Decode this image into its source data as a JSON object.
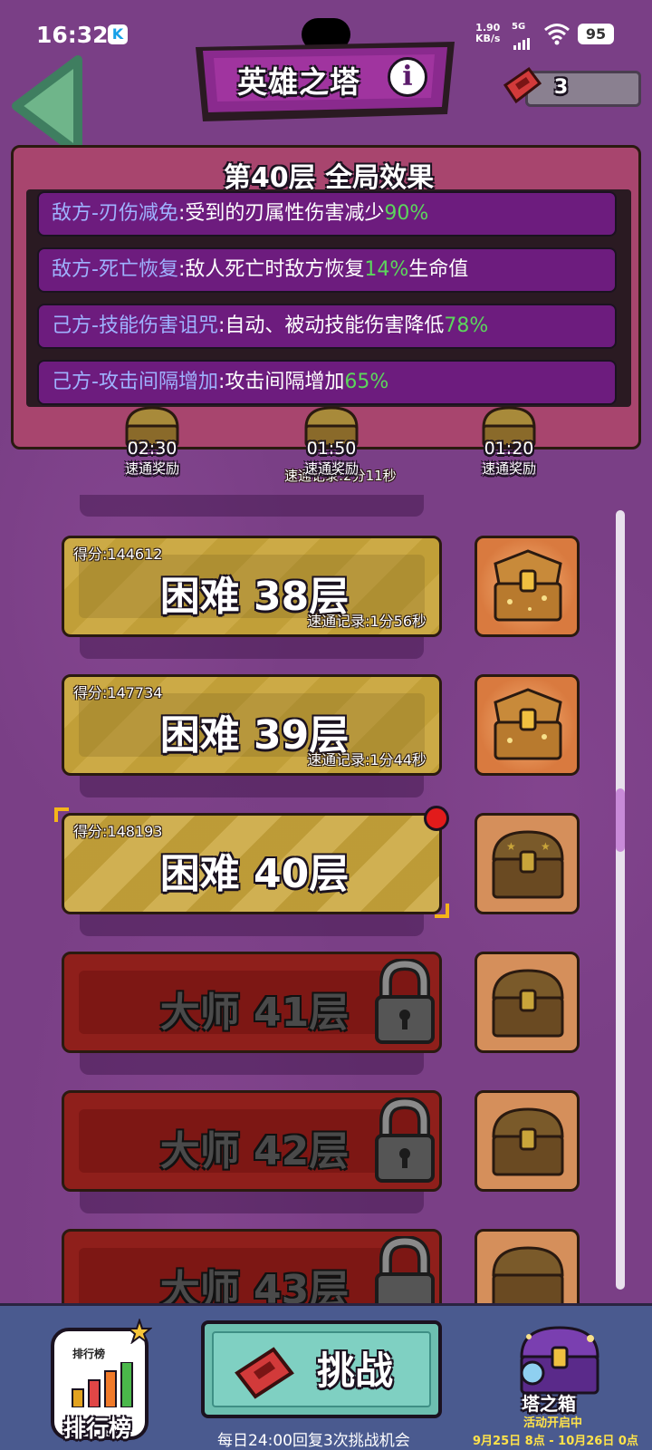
{
  "status_bar": {
    "time": "16:32",
    "app_badge": "K",
    "net_speed_value": "1.90",
    "net_speed_unit": "KB/s",
    "network": "5G",
    "battery": "95"
  },
  "header": {
    "title": "英雄之塔",
    "info_glyph": "i",
    "ticket_count": "3"
  },
  "effects": {
    "title": "第40层 全局效果",
    "items": [
      {
        "name": "敌方-刃伤减免",
        "text": ":受到的刃属性伤害减少",
        "value": "90%",
        "suffix": ""
      },
      {
        "name": "敌方-死亡恢复",
        "text": ":敌人死亡时敌方恢复",
        "value": "14%",
        "suffix": "生命值"
      },
      {
        "name": "己方-技能伤害诅咒",
        "text": ":自动、被动技能伤害降低",
        "value": "78%",
        "suffix": ""
      },
      {
        "name": "己方-攻击间隔增加",
        "text": ":攻击间隔增加",
        "value": "65%",
        "suffix": ""
      }
    ],
    "speed_rewards": [
      {
        "time": "02:30",
        "label": "速通奖励"
      },
      {
        "time": "01:50",
        "label": "速通奖励"
      },
      {
        "time": "01:20",
        "label": "速通奖励"
      }
    ],
    "partial_record": "速通记录:2分11秒"
  },
  "levels": [
    {
      "score": "得分:144612",
      "name": "困难 38层",
      "record": "速通记录:1分56秒"
    },
    {
      "score": "得分:147734",
      "name": "困难 39层",
      "record": "速通记录:1分44秒"
    },
    {
      "score": "得分:148193",
      "name": "困难 40层",
      "record": ""
    },
    {
      "score": "",
      "name": "大师 41层",
      "record": ""
    },
    {
      "score": "",
      "name": "大师 42层",
      "record": ""
    },
    {
      "score": "",
      "name": "大师 43层",
      "record": ""
    }
  ],
  "bottom_bar": {
    "rank_mini": "排行榜",
    "rank_label": "排行榜",
    "challenge_label": "挑战",
    "refresh_note": "每日24:00回复3次挑战机会",
    "tower_label": "塔之箱",
    "event_status": "活动开启中",
    "event_dates": "9月25日 8点 - 10月26日 0点"
  },
  "colors": {
    "background": "#7a3f86",
    "effect_value": "#5cd65c",
    "effect_name": "#9fb2ff",
    "gold_card": "#c9a53a",
    "locked_card": "#8f1f1b",
    "bottom_bar": "#4a5a8f"
  }
}
